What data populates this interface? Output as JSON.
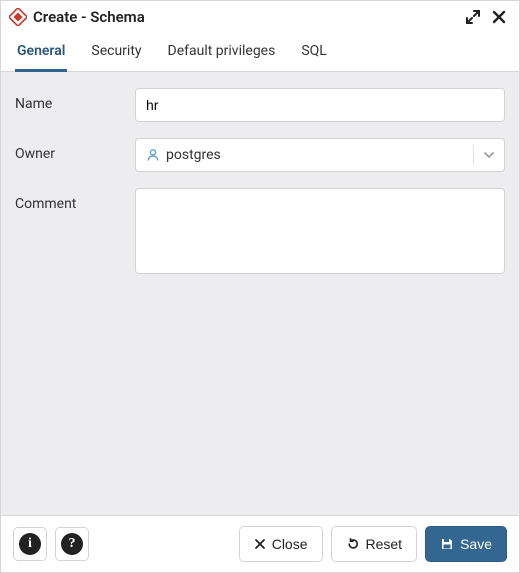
{
  "window": {
    "title": "Create - Schema"
  },
  "tabs": {
    "general": "General",
    "security": "Security",
    "default_privileges": "Default privileges",
    "sql": "SQL"
  },
  "form": {
    "name_label": "Name",
    "name_value": "hr",
    "owner_label": "Owner",
    "owner_value": "postgres",
    "comment_label": "Comment",
    "comment_value": ""
  },
  "footer": {
    "close": "Close",
    "reset": "Reset",
    "save": "Save"
  },
  "colors": {
    "primary": "#336791",
    "user_icon": "#5f9fd8"
  }
}
